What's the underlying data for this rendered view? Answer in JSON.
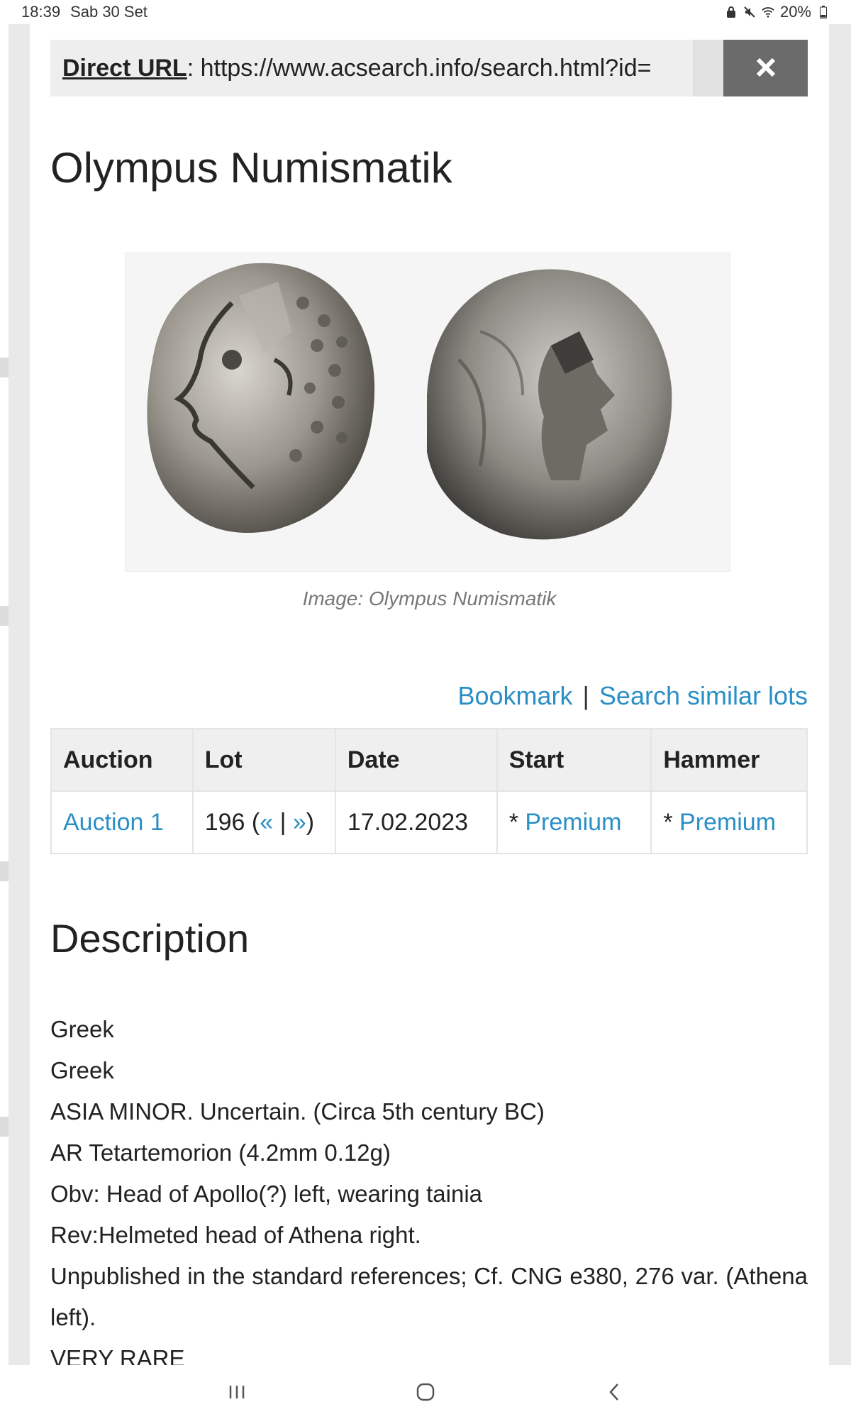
{
  "status_bar": {
    "time": "18:39",
    "date": "Sab 30 Set",
    "battery": "20%"
  },
  "modal": {
    "url_label": "Direct URL",
    "url_value": ": https://www.acsearch.info/search.html?id=",
    "close_icon": "close-icon",
    "title": "Olympus Numismatik",
    "image_caption": "Image: Olympus Numismatik",
    "links": {
      "bookmark": "Bookmark",
      "separator": "|",
      "search_similar": "Search similar lots"
    },
    "table": {
      "headers": [
        "Auction",
        "Lot",
        "Date",
        "Start",
        "Hammer"
      ],
      "row": {
        "auction": "Auction 1",
        "lot_number": "196 (",
        "lot_prev": "«",
        "lot_sep": " | ",
        "lot_next": "»",
        "lot_close": ")",
        "date": "17.02.2023",
        "start_prefix": "* ",
        "start_link": "Premium",
        "hammer_prefix": "* ",
        "hammer_link": "Premium"
      }
    },
    "description": {
      "heading": "Description",
      "lines": [
        "Greek",
        "Greek",
        "ASIA MINOR. Uncertain. (Circa 5th century BC)",
        "AR Tetartemorion (4.2mm 0.12g)",
        "Obv: Head of Apollo(?) left, wearing tainia",
        "Rev:Helmeted head of Athena right.",
        "Unpublished in the standard references; Cf. CNG e380, 276 var. (Athena left).",
        "VERY RARE"
      ]
    }
  },
  "colors": {
    "link": "#2a8fc5",
    "close_button": "#6b6b6b"
  }
}
